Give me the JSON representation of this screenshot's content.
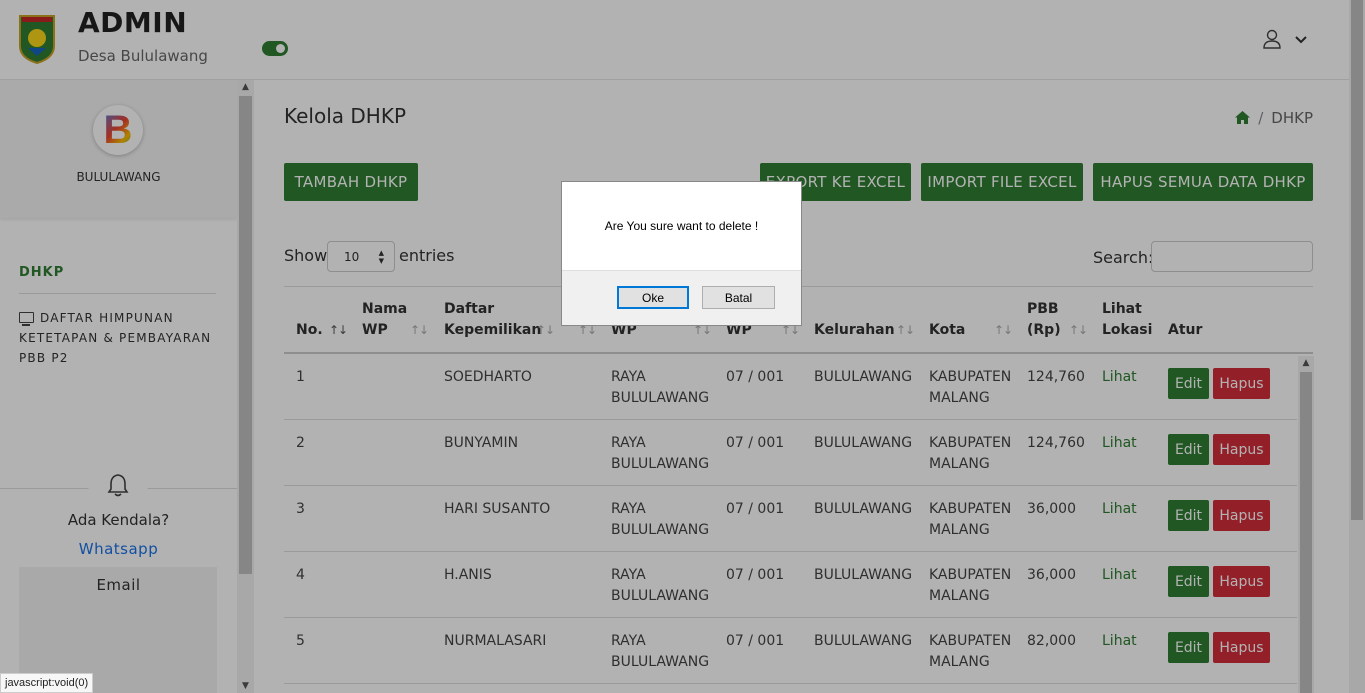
{
  "header": {
    "title": "ADMIN",
    "subtitle": "Desa Bululawang",
    "toggle_on": true
  },
  "sidebar": {
    "profile_name": "BULULAWANG",
    "avatar_letter": "B",
    "section": "DHKP",
    "item_label": "DAFTAR HIMPUNAN KETETAPAN & PEMBAYARAN PBB P2",
    "help_title": "Ada Kendala?",
    "help_whatsapp": "Whatsapp",
    "help_email": "Email"
  },
  "main": {
    "title": "Kelola DHKP",
    "breadcrumb": "DHKP",
    "buttons": {
      "add": "TAMBAH DHKP",
      "export": "EXPORT KE EXCEL",
      "import": "IMPORT FILE EXCEL",
      "delete_all": "HAPUS SEMUA DATA DHKP"
    },
    "show_label": "Show",
    "entries_value": "10",
    "entries_label": "entries",
    "search_label": "Search:",
    "columns": {
      "no": "No.",
      "nama_line1": "Nama",
      "nama_line2": "WP",
      "daftar_line1": "Daftar",
      "daftar_line2": "Kepemilikan",
      "alamat_wp": "WP",
      "rt_wp": "WP",
      "kelurahan": "Kelurahan",
      "kota": "Kota",
      "pbb_line1": "PBB",
      "pbb_line2": "(Rp)",
      "lokasi_line1": "Lihat",
      "lokasi_line2": "Lokasi",
      "atur": "Atur"
    },
    "rows": [
      {
        "no": "1",
        "kepemilikan": "SOEDHARTO",
        "alamat1": "RAYA",
        "alamat2": "BULULAWANG",
        "rt": "07 / 001",
        "kelurahan": "BULULAWANG",
        "kota1": "KABUPATEN",
        "kota2": "MALANG",
        "pbb": "124,760",
        "lihat": "Lihat",
        "edit": "Edit",
        "hapus": "Hapus"
      },
      {
        "no": "2",
        "kepemilikan": "BUNYAMIN",
        "alamat1": "RAYA",
        "alamat2": "BULULAWANG",
        "rt": "07 / 001",
        "kelurahan": "BULULAWANG",
        "kota1": "KABUPATEN",
        "kota2": "MALANG",
        "pbb": "124,760",
        "lihat": "Lihat",
        "edit": "Edit",
        "hapus": "Hapus"
      },
      {
        "no": "3",
        "kepemilikan": "HARI SUSANTO",
        "alamat1": "RAYA",
        "alamat2": "BULULAWANG",
        "rt": "07 / 001",
        "kelurahan": "BULULAWANG",
        "kota1": "KABUPATEN",
        "kota2": "MALANG",
        "pbb": "36,000",
        "lihat": "Lihat",
        "edit": "Edit",
        "hapus": "Hapus"
      },
      {
        "no": "4",
        "kepemilikan": "H.ANIS",
        "alamat1": "RAYA",
        "alamat2": "BULULAWANG",
        "rt": "07 / 001",
        "kelurahan": "BULULAWANG",
        "kota1": "KABUPATEN",
        "kota2": "MALANG",
        "pbb": "36,000",
        "lihat": "Lihat",
        "edit": "Edit",
        "hapus": "Hapus"
      },
      {
        "no": "5",
        "kepemilikan": "NURMALASARI",
        "alamat1": "RAYA",
        "alamat2": "BULULAWANG",
        "rt": "07 / 001",
        "kelurahan": "BULULAWANG",
        "kota1": "KABUPATEN",
        "kota2": "MALANG",
        "pbb": "82,000",
        "lihat": "Lihat",
        "edit": "Edit",
        "hapus": "Hapus"
      }
    ]
  },
  "dialog": {
    "message": "Are You sure want to delete !",
    "ok": "Oke",
    "cancel": "Batal"
  },
  "status_bar": "javascript:void(0)",
  "colors": {
    "primary_green": "#2e7d32",
    "danger_red": "#d32f3c",
    "link_blue": "#1a73e8"
  },
  "icons": [
    "logo-emblem-icon",
    "user-icon",
    "chevron-down-icon",
    "home-icon",
    "monitor-icon",
    "bell-icon"
  ]
}
